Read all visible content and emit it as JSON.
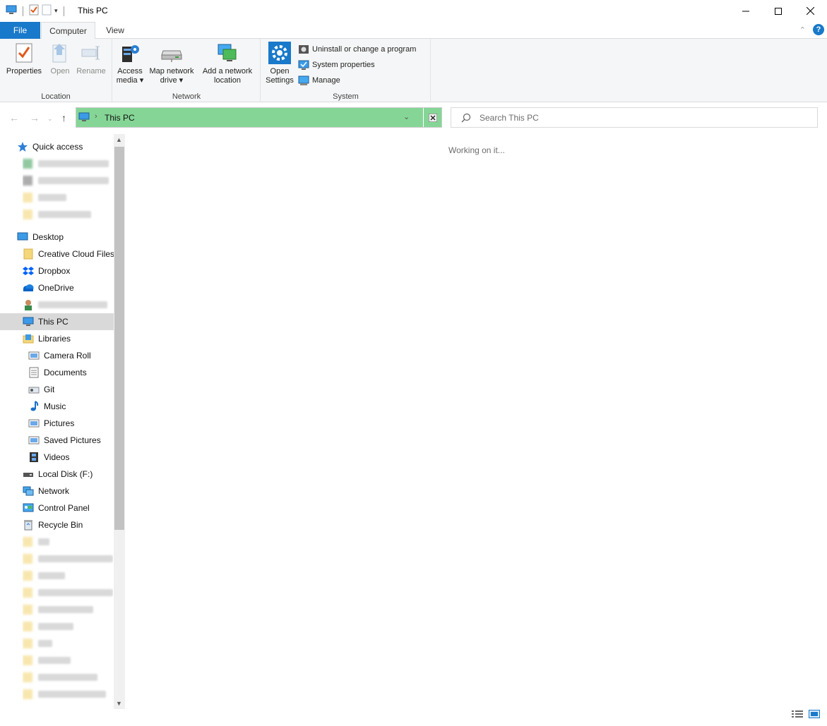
{
  "window": {
    "title": "This PC",
    "minimize_label": "—",
    "maximize_label": "☐",
    "close_label": "✕"
  },
  "tabs": {
    "file": "File",
    "computer": "Computer",
    "view": "View"
  },
  "ribbon": {
    "location": {
      "label": "Location",
      "properties": "Properties",
      "open": "Open",
      "rename": "Rename"
    },
    "network": {
      "label": "Network",
      "access_media_1": "Access",
      "access_media_2": "media",
      "map_drive_1": "Map network",
      "map_drive_2": "drive",
      "add_location_1": "Add a network",
      "add_location_2": "location"
    },
    "system": {
      "label": "System",
      "open_settings_1": "Open",
      "open_settings_2": "Settings",
      "uninstall": "Uninstall or change a program",
      "system_properties": "System properties",
      "manage": "Manage"
    }
  },
  "address": {
    "path": "This PC",
    "search_placeholder": "Search This PC"
  },
  "nav": {
    "quick_access": "Quick access",
    "desktop": "Desktop",
    "creative_cloud": "Creative Cloud Files",
    "dropbox": "Dropbox",
    "onedrive": "OneDrive",
    "this_pc": "This PC",
    "libraries": "Libraries",
    "camera_roll": "Camera Roll",
    "documents": "Documents",
    "git": "Git",
    "music": "Music",
    "pictures": "Pictures",
    "saved_pictures": "Saved Pictures",
    "videos": "Videos",
    "local_disk": "Local Disk (F:)",
    "network": "Network",
    "control_panel": "Control Panel",
    "recycle_bin": "Recycle Bin"
  },
  "content": {
    "status_message": "Working on it..."
  },
  "colors": {
    "accent": "#1979ca",
    "address_highlight": "#85d696",
    "selected_nav": "#d9d9d9"
  }
}
